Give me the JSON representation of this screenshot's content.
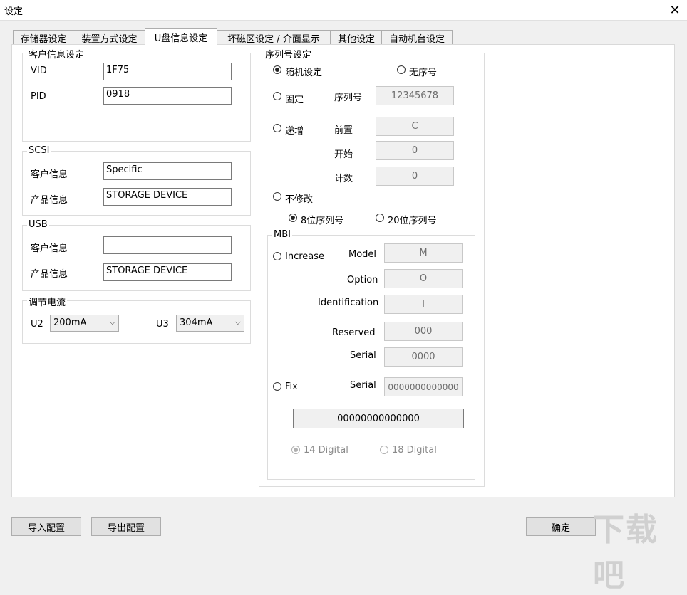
{
  "window": {
    "title": "设定",
    "close_glyph": "✕"
  },
  "tabs": [
    "存储器设定",
    "装置方式设定",
    "U盘信息设定",
    "坏磁区设定 / 介面显示",
    "其他设定",
    "自动机台设定"
  ],
  "customer": {
    "label": "客户信息设定",
    "vid_label": "VID",
    "vid_value": "1F75",
    "pid_label": "PID",
    "pid_value": "0918"
  },
  "scsi": {
    "label": "SCSI",
    "customer_label": "客户信息",
    "customer_value": "Specific",
    "product_label": "产品信息",
    "product_value": "STORAGE DEVICE"
  },
  "usb": {
    "label": "USB",
    "customer_label": "客户信息",
    "customer_value": "",
    "product_label": "产品信息",
    "product_value": "STORAGE DEVICE"
  },
  "current": {
    "label": "调节电流",
    "u2_label": "U2",
    "u2_value": "200mA",
    "u3_label": "U3",
    "u3_value": "304mA"
  },
  "serial": {
    "label": "序列号设定",
    "random": "随机设定",
    "none": "无序号",
    "fixed": "固定",
    "serial_label": "序列号",
    "serial_value": "12345678",
    "increment": "递增",
    "prefix_label": "前置",
    "prefix_value": "C",
    "start_label": "开始",
    "start_value": "0",
    "count_label": "计数",
    "count_value": "0",
    "nochange": "不修改",
    "bit8": "8位序列号",
    "bit20": "20位序列号"
  },
  "mbi": {
    "label": "MBI",
    "increase": "Increase",
    "model_label": "Model",
    "model_value": "M",
    "option_label": "Option",
    "option_value": "O",
    "ident_label": "Identification",
    "ident_value": "I",
    "reserved_label": "Reserved",
    "reserved_value": "000",
    "serial_label": "Serial",
    "serial_value": "0000",
    "fix": "Fix",
    "fix_serial_label": "Serial",
    "fix_serial_value": "0000000000000",
    "result_value": "00000000000000",
    "digit14": "14 Digital",
    "digit18": "18 Digital"
  },
  "footer": {
    "import": "导入配置",
    "export": "导出配置",
    "ok": "确定"
  },
  "watermark": "下载吧"
}
